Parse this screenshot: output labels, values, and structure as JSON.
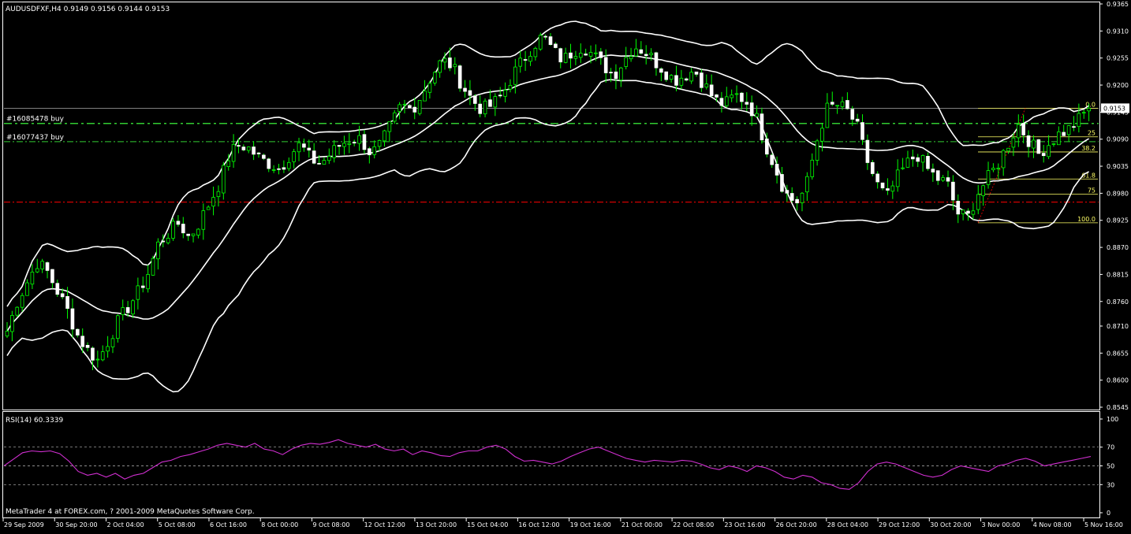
{
  "header": {
    "symbol_line": "AUDUSDFXF,H4  0.9149 0.9156 0.9144 0.9153",
    "rsi_label": "RSI(14) 60.3339",
    "copyright": "MetaTrader 4 at FOREX.com, ? 2001-2009 MetaQuotes Software Corp."
  },
  "colors": {
    "background": "#000000",
    "frame": "#ffffff",
    "bull_candle": "#00ff00",
    "bear_candle": "#ffffff",
    "bands": "#ffffff",
    "order_line": "#32cd32",
    "stop_line": "#ff0000",
    "fib": "#ffff66",
    "rsi": "#d12fd1",
    "price_tag_bg": "#ffffff",
    "price_tag_fg": "#000000"
  },
  "chart_data": [
    {
      "type": "candlestick",
      "series": [
        {
          "name": "AUDUSDFXF,H4"
        }
      ],
      "ylim": [
        0.8545,
        0.9365
      ],
      "y_ticks": [
        "0.9365",
        "0.9310",
        "0.9255",
        "0.9200",
        "0.9145",
        "0.9090",
        "0.9035",
        "0.8980",
        "0.8925",
        "0.8870",
        "0.8815",
        "0.8760",
        "0.8710",
        "0.8655",
        "0.8600",
        "0.8545"
      ],
      "y_tick_values": [
        0.9365,
        0.931,
        0.9255,
        0.92,
        0.9145,
        0.909,
        0.9035,
        0.898,
        0.8925,
        0.887,
        0.8815,
        0.876,
        0.871,
        0.8655,
        0.86,
        0.8545
      ],
      "x_ticks": [
        "29 Sep 2009",
        "30 Sep 20:00",
        "2 Oct 04:00",
        "5 Oct 08:00",
        "6 Oct 16:00",
        "8 Oct 00:00",
        "9 Oct 08:00",
        "12 Oct 12:00",
        "13 Oct 20:00",
        "15 Oct 04:00",
        "16 Oct 12:00",
        "19 Oct 16:00",
        "21 Oct 00:00",
        "22 Oct 08:00",
        "23 Oct 16:00",
        "26 Oct 20:00",
        "28 Oct 04:00",
        "29 Oct 12:00",
        "30 Oct 20:00",
        "3 Nov 00:00",
        "4 Nov 08:00",
        "5 Nov 16:00"
      ],
      "close_path": [
        0.87,
        0.876,
        0.88,
        0.884,
        0.882,
        0.878,
        0.874,
        0.869,
        0.866,
        0.864,
        0.868,
        0.872,
        0.875,
        0.878,
        0.882,
        0.888,
        0.89,
        0.892,
        0.889,
        0.892,
        0.896,
        0.9,
        0.906,
        0.908,
        0.907,
        0.905,
        0.904,
        0.903,
        0.906,
        0.908,
        0.905,
        0.904,
        0.906,
        0.908,
        0.909,
        0.909,
        0.906,
        0.908,
        0.912,
        0.916,
        0.915,
        0.918,
        0.922,
        0.925,
        0.924,
        0.92,
        0.917,
        0.915,
        0.916,
        0.918,
        0.922,
        0.925,
        0.928,
        0.93,
        0.927,
        0.925,
        0.927,
        0.928,
        0.926,
        0.924,
        0.922,
        0.925,
        0.928,
        0.927,
        0.925,
        0.923,
        0.921,
        0.922,
        0.923,
        0.92,
        0.917,
        0.916,
        0.918,
        0.917,
        0.914,
        0.908,
        0.903,
        0.898,
        0.896,
        0.899,
        0.908,
        0.915,
        0.916,
        0.915,
        0.912,
        0.905,
        0.9,
        0.897,
        0.901,
        0.904,
        0.906,
        0.903,
        0.901,
        0.9,
        0.894,
        0.893,
        0.898,
        0.901,
        0.904,
        0.908,
        0.912,
        0.909,
        0.906,
        0.908,
        0.91,
        0.911,
        0.913,
        0.9153
      ],
      "last_price": "0.9153",
      "orders": [
        {
          "label": "#16085478 buy",
          "price": 0.9122
        },
        {
          "label": "#16077437 buy",
          "price": 0.9085
        }
      ],
      "stop_price": 0.8962,
      "fibonacci": {
        "levels": [
          "0.0",
          "25",
          "38.2",
          "61.8",
          "75",
          "100.0"
        ],
        "high": 0.9153,
        "low": 0.892
      },
      "bollinger_bands": true
    },
    {
      "type": "line",
      "series": [
        {
          "name": "RSI(14)"
        }
      ],
      "ylim": [
        0,
        100
      ],
      "y_ticks": [
        "100",
        "70",
        "50",
        "30",
        "0"
      ],
      "y_tick_values": [
        100,
        70,
        50,
        30,
        0
      ],
      "levels": [
        70,
        50,
        30
      ],
      "values": [
        50,
        57,
        64,
        66,
        65,
        66,
        63,
        55,
        44,
        40,
        42,
        38,
        42,
        36,
        40,
        42,
        48,
        54,
        56,
        60,
        62,
        65,
        68,
        72,
        74,
        72,
        70,
        74,
        68,
        66,
        62,
        68,
        72,
        74,
        73,
        75,
        78,
        74,
        72,
        70,
        73,
        68,
        66,
        68,
        62,
        66,
        64,
        61,
        60,
        64,
        66,
        66,
        70,
        72,
        68,
        60,
        55,
        56,
        54,
        52,
        55,
        60,
        64,
        68,
        70,
        66,
        62,
        58,
        56,
        54,
        56,
        55,
        54,
        56,
        55,
        52,
        48,
        46,
        50,
        48,
        44,
        50,
        48,
        44,
        38,
        36,
        40,
        38,
        32,
        30,
        26,
        25,
        32,
        44,
        52,
        54,
        52,
        48,
        44,
        40,
        38,
        40,
        46,
        50,
        48,
        46,
        44,
        50,
        52,
        56,
        58,
        55,
        50,
        52,
        54,
        56,
        58,
        60
      ]
    }
  ]
}
